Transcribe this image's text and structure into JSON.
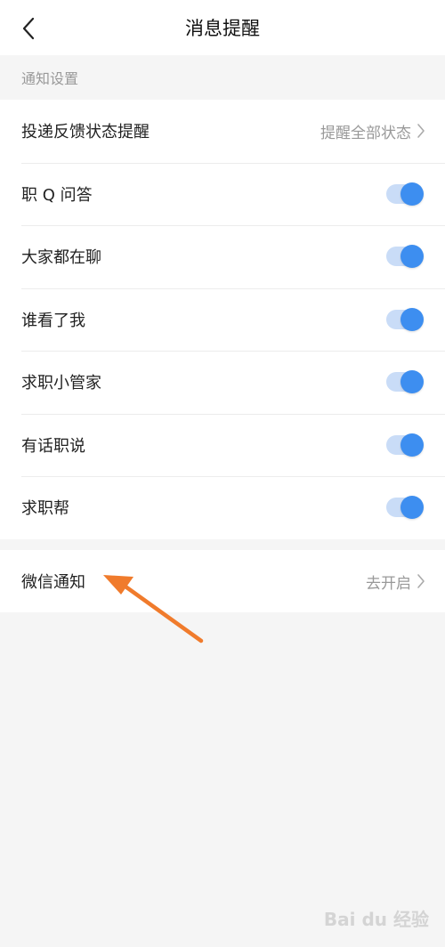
{
  "header": {
    "title": "消息提醒",
    "back_icon": "chevron-left-icon"
  },
  "section": {
    "label": "通知设置"
  },
  "settings": [
    {
      "label": "投递反馈状态提醒",
      "kind": "link",
      "value": "提醒全部状态"
    },
    {
      "label": "职 Q 问答",
      "kind": "toggle",
      "enabled": true
    },
    {
      "label": "大家都在聊",
      "kind": "toggle",
      "enabled": true
    },
    {
      "label": "谁看了我",
      "kind": "toggle",
      "enabled": true
    },
    {
      "label": "求职小管家",
      "kind": "toggle",
      "enabled": true
    },
    {
      "label": "有话职说",
      "kind": "toggle",
      "enabled": true
    },
    {
      "label": "求职帮",
      "kind": "toggle",
      "enabled": true
    }
  ],
  "wechat": {
    "label": "微信通知",
    "value": "去开启"
  },
  "colors": {
    "accent": "#3d8ef0",
    "toggle_track": "#c9dcf7",
    "annotation_arrow": "#f07b2c"
  },
  "watermark": {
    "text": "Bai du 经验"
  }
}
